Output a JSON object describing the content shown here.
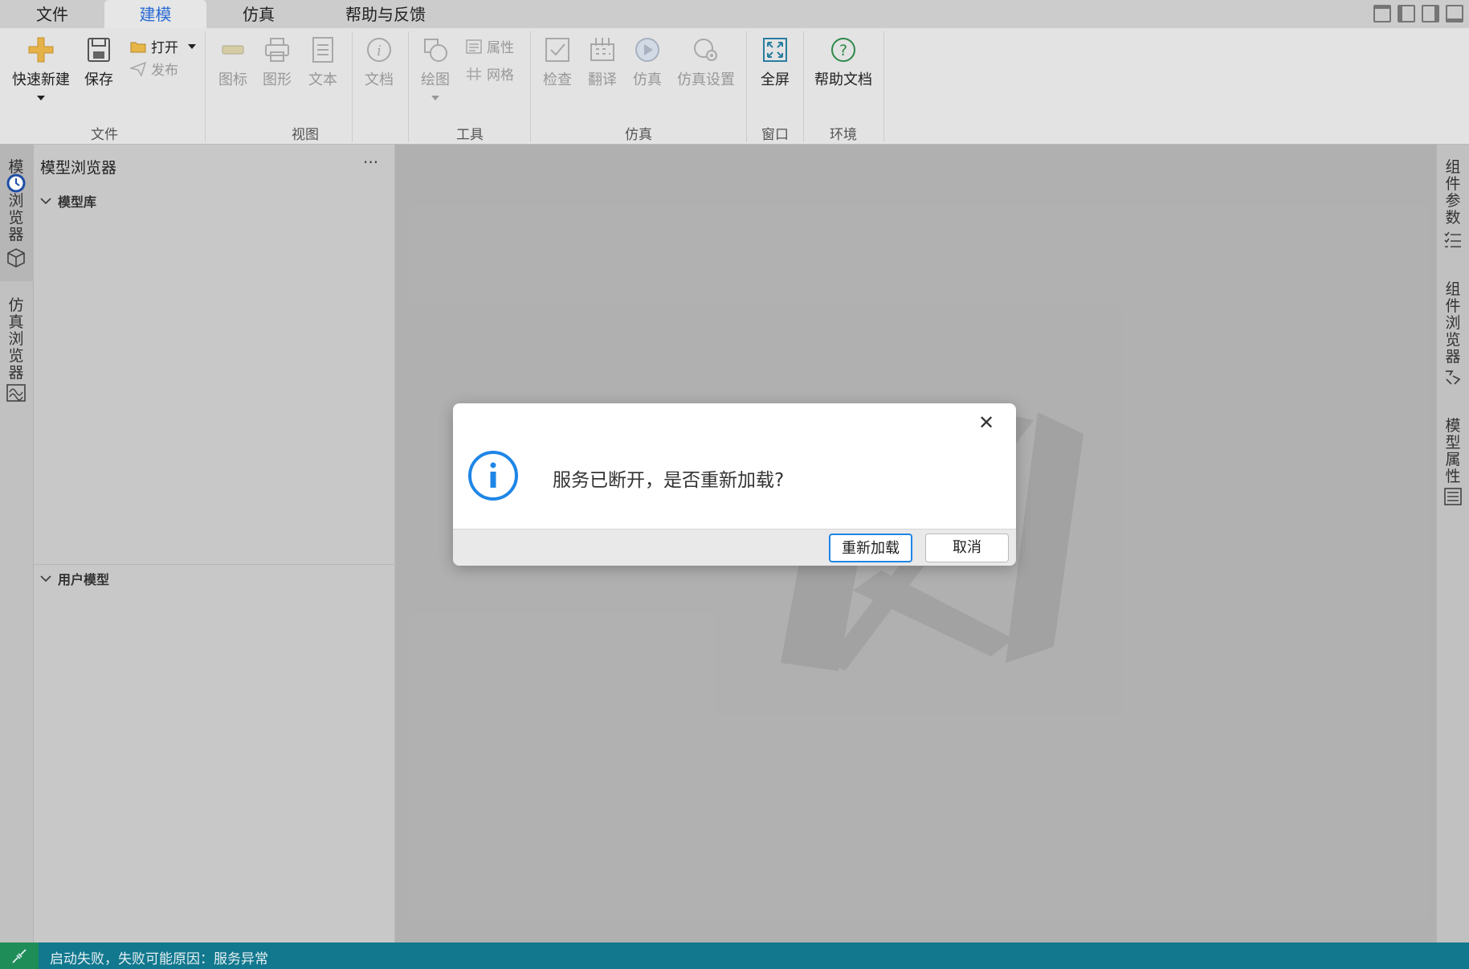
{
  "tabs": {
    "file": "文件",
    "modeling": "建模",
    "simulation": "仿真",
    "help": "帮助与反馈"
  },
  "ribbon": {
    "quick_new": "快速新建",
    "save": "保存",
    "open": "打开",
    "publish": "发布",
    "icon": "图标",
    "graphic": "图形",
    "text": "文本",
    "doc": "文档",
    "draw": "绘图",
    "properties": "属性",
    "grid": "网格",
    "check": "检查",
    "translate": "翻译",
    "simulate": "仿真",
    "sim_settings": "仿真设置",
    "fullscreen": "全屏",
    "help_doc": "帮助文档",
    "groups": {
      "file": "文件",
      "view": "视图",
      "tools": "工具",
      "simulation": "仿真",
      "window": "窗口",
      "environment": "环境"
    }
  },
  "left_rail": {
    "model_browser": "模型浏览器",
    "sim_browser": "仿真浏览器"
  },
  "panel": {
    "title": "模型浏览器",
    "more": "···",
    "model_library": "模型库",
    "user_models": "用户模型"
  },
  "right_rail": {
    "component_params": "组件参数",
    "component_browser": "组件浏览器",
    "model_properties": "模型属性"
  },
  "dialog": {
    "message": "服务已断开，是否重新加载?",
    "reload": "重新加载",
    "cancel": "取消"
  },
  "status": {
    "message": "启动失败，失败可能原因：服务异常"
  },
  "colors": {
    "accent": "#2d6ed6",
    "info": "#1e86e6",
    "status_bar": "#127a90"
  }
}
